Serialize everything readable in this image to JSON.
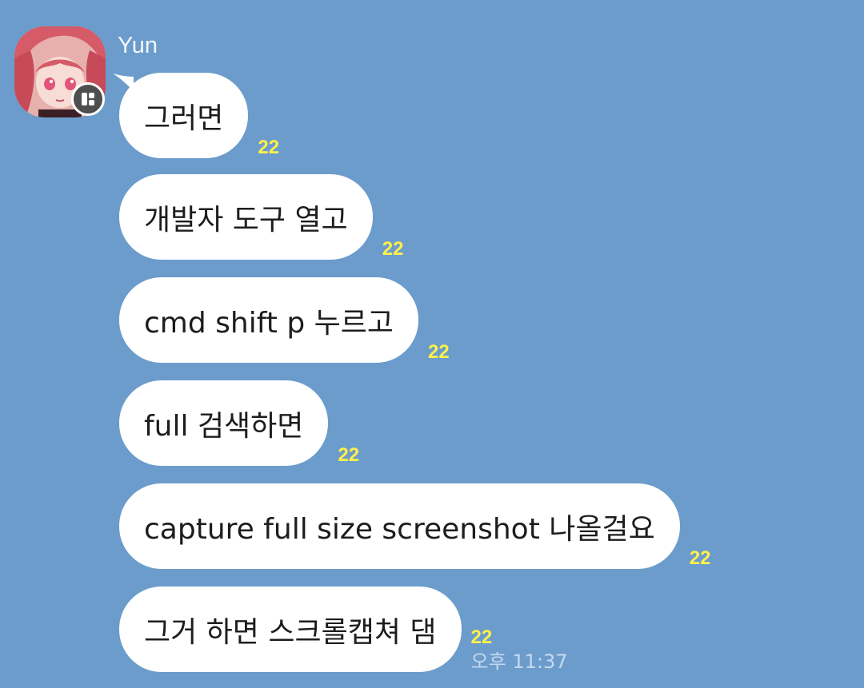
{
  "sender": {
    "name": "Yun",
    "avatar_icon": "anime-girl-avatar",
    "badge_icon": "profile-badge-icon"
  },
  "colors": {
    "background": "#6b9ccc",
    "bubble": "#ffffff",
    "unread_count": "#fff04a",
    "timestamp": "#c7d9ee"
  },
  "messages": [
    {
      "text": "그러면",
      "unread": "22"
    },
    {
      "text": "개발자 도구 열고",
      "unread": "22"
    },
    {
      "text": "cmd shift p 누르고",
      "unread": "22"
    },
    {
      "text": "full 검색하면",
      "unread": "22"
    },
    {
      "text": "capture full size screenshot 나올걸요",
      "unread": "22"
    },
    {
      "text": "그거 하면 스크롤캡쳐 댐",
      "unread": "22",
      "time": "오후 11:37"
    }
  ]
}
